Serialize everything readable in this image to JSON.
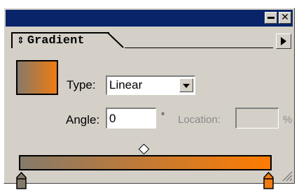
{
  "panel": {
    "tab": {
      "label": "Gradient",
      "arrows_glyph": "⇕"
    },
    "titlebar": {
      "minimize_glyph": "",
      "close_glyph": "✕"
    }
  },
  "gradient": {
    "start_color": "#857a6a",
    "end_color": "#f07b12",
    "type_label": "Type:",
    "type_value": "Linear",
    "angle_label": "Angle:",
    "angle_value": "0",
    "degree_symbol": "°",
    "location_label": "Location:",
    "location_value": "",
    "percent_symbol": "%"
  },
  "icons": {
    "tab_arrows": "up-down-arrows-icon",
    "menu": "panel-menu-arrow-icon",
    "midpoint": "diamond-midpoint-icon",
    "stop": "color-stop-icon",
    "resize": "resize-grip-icon"
  }
}
